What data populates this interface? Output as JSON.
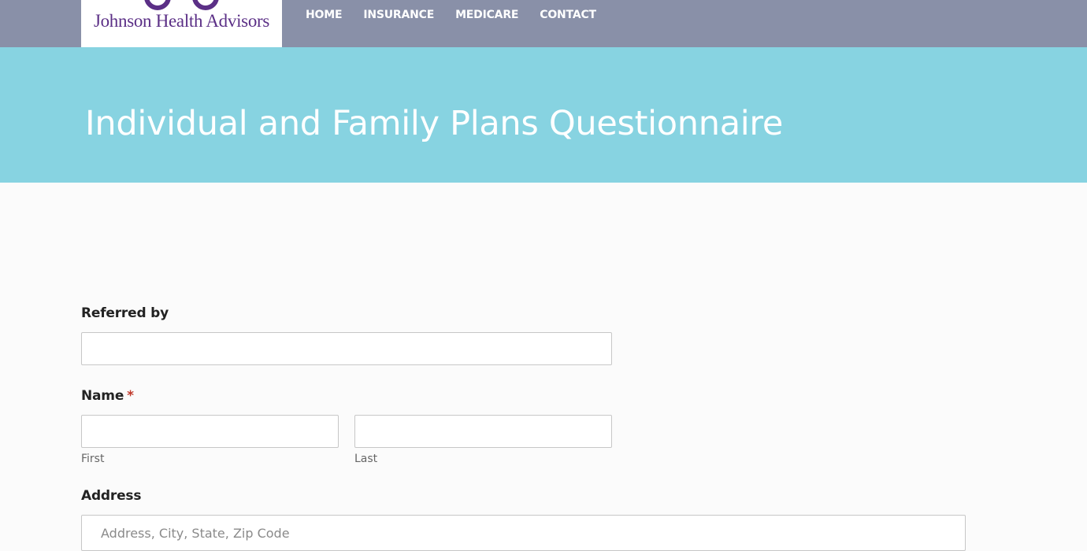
{
  "header": {
    "logo_text": "Johnson Health Advisors",
    "brand_color": "#5b2f86",
    "bar_color": "#8990a8",
    "nav": [
      {
        "label": "HOME"
      },
      {
        "label": "INSURANCE"
      },
      {
        "label": "MEDICARE"
      },
      {
        "label": "CONTACT"
      }
    ]
  },
  "hero": {
    "title": "Individual and Family Plans Questionnaire",
    "bg_color": "#87d3e1"
  },
  "form": {
    "referred_by": {
      "label": "Referred by",
      "value": ""
    },
    "name": {
      "label": "Name",
      "required_marker": "*",
      "first": {
        "value": "",
        "sublabel": "First"
      },
      "last": {
        "value": "",
        "sublabel": "Last"
      }
    },
    "address": {
      "label": "Address",
      "value": "",
      "placeholder": "Address, City, State, Zip Code"
    }
  }
}
